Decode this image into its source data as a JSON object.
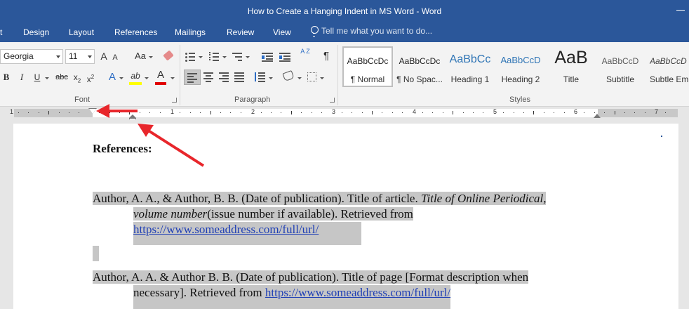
{
  "window": {
    "title": "How to Create a Hanging Indent in MS Word",
    "title_full": "How to Create a Hanging Indent in MS Word - Word"
  },
  "menu": {
    "tabs": [
      "t",
      "Design",
      "Layout",
      "References",
      "Mailings",
      "Review",
      "View"
    ],
    "tell_me": "Tell me what you want to do..."
  },
  "font": {
    "name": "Georgia",
    "size": "11",
    "grow": "A",
    "shrink": "A",
    "change_case": "Aa",
    "bold": "B",
    "italic": "I",
    "underline": "U",
    "strike": "abc",
    "subscript": "x",
    "superscript": "x",
    "text_effects": "A",
    "highlight": "ab",
    "font_color": "A",
    "group_label": "Font",
    "highlight_color": "#ffff00",
    "font_color_value": "#e00000"
  },
  "paragraph": {
    "group_label": "Paragraph",
    "sort": "A Z",
    "pilcrow": "¶"
  },
  "styles": {
    "group_label": "Styles",
    "items": [
      {
        "sample": "AaBbCcDc",
        "name": "¶ Normal"
      },
      {
        "sample": "AaBbCcDc",
        "name": "¶ No Spac..."
      },
      {
        "sample": "AaBbCc",
        "name": "Heading 1"
      },
      {
        "sample": "AaBbCcD",
        "name": "Heading 2"
      },
      {
        "sample": "AaB",
        "name": "Title"
      },
      {
        "sample": "AaBbCcD",
        "name": "Subtitle"
      },
      {
        "sample": "AaBbCcD",
        "name": "Subtle Em..."
      }
    ]
  },
  "ruler": {
    "numbers": [
      "1",
      "1",
      "2",
      "3",
      "4",
      "5",
      "6",
      "7"
    ]
  },
  "document": {
    "heading": "References:",
    "entry1": {
      "line1_a": "Author, A. A., & Author, B. B. (Date of publication). Title of article. ",
      "line1_b": "Title of Online Periodical,",
      "line2_a": "volume number",
      "line2_b": "(issue number if available). Retrieved from",
      "link": "https://www.someaddress.com/full/url/"
    },
    "entry2": {
      "line1": "Author, A. A. & Author B. B. (Date of publication). Title of page [Format description when",
      "line2_a": "necessary]. Retrieved from ",
      "link": "https://www.someaddress.com/full/url/"
    }
  },
  "colors": {
    "accent": "#2b579a",
    "arrow": "#e8262b",
    "link": "#1f3fb5",
    "highlight": "#c6c6c6"
  }
}
